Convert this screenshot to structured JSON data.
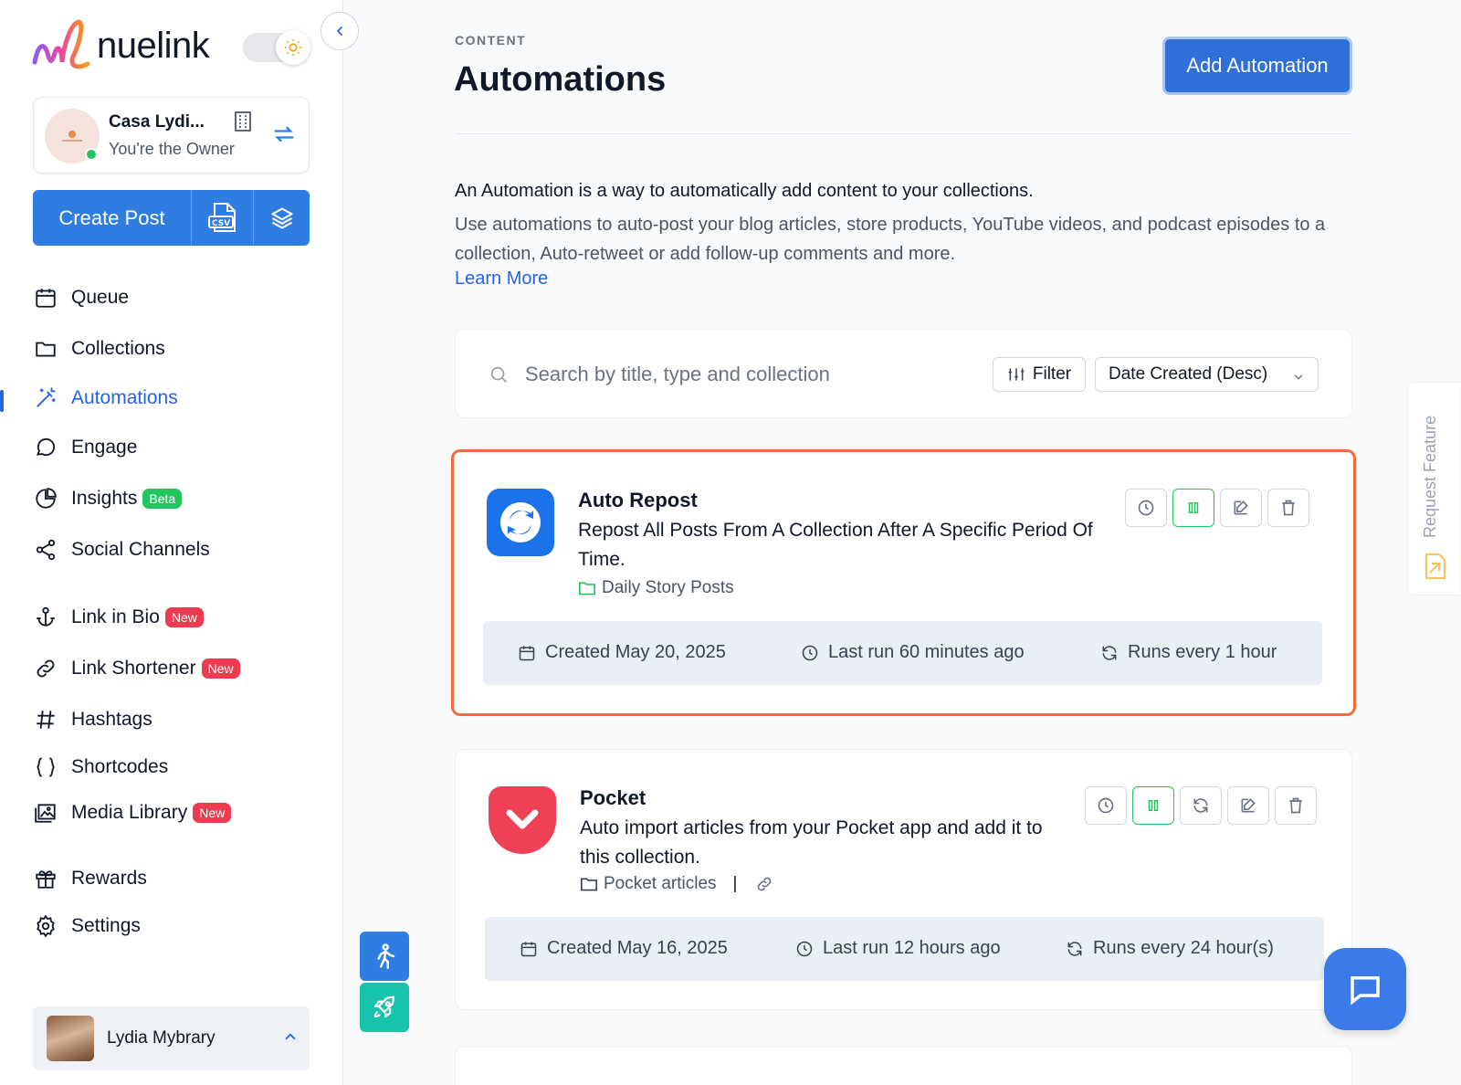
{
  "brand": {
    "name": "nuelink"
  },
  "account": {
    "name": "Casa Lydi...",
    "role": "You're the Owner"
  },
  "create": {
    "label": "Create Post",
    "csv_icon": "csv-file-icon",
    "layers_icon": "layers-icon"
  },
  "nav": {
    "queue": "Queue",
    "collections": "Collections",
    "automations": "Automations",
    "engage": "Engage",
    "insights": "Insights",
    "insights_badge": "Beta",
    "social_channels": "Social Channels",
    "link_in_bio": "Link in Bio",
    "link_in_bio_badge": "New",
    "link_shortener": "Link Shortener",
    "link_shortener_badge": "New",
    "hashtags": "Hashtags",
    "shortcodes": "Shortcodes",
    "media_library": "Media Library",
    "media_library_badge": "New",
    "rewards": "Rewards",
    "settings": "Settings"
  },
  "user": {
    "name": "Lydia Mybrary"
  },
  "header": {
    "breadcrumb": "CONTENT",
    "title": "Automations",
    "add_button": "Add Automation"
  },
  "intro": {
    "line1": "An Automation is a way to automatically add content to your collections.",
    "line2": "Use automations to auto-post your blog articles, store products, YouTube videos, and podcast episodes to a collection, Auto-retweet or add follow-up comments and more.",
    "learn_more": "Learn More"
  },
  "search": {
    "placeholder": "Search by title, type and collection",
    "filter_label": "Filter",
    "sort_value": "Date Created (Desc)"
  },
  "automations": [
    {
      "title": "Auto Repost",
      "description": "Repost All Posts From A Collection After A Specific Period Of Time.",
      "collection": "Daily Story Posts",
      "created": "Created May 20, 2025",
      "last_run": "Last run 60 minutes ago",
      "frequency": "Runs every 1 hour",
      "icon_color": "#1a73e8"
    },
    {
      "title": "Pocket",
      "description": "Auto import articles from your Pocket app and add it to this collection.",
      "collection": "Pocket articles",
      "separator": "|",
      "created": "Created May 16, 2025",
      "last_run": "Last run 12 hours ago",
      "frequency": "Runs every 24 hour(s)",
      "icon_color": "#ef4056"
    }
  ],
  "request_feature": "Request Feature",
  "colors": {
    "primary": "#2f7de1",
    "highlight_border": "#f26b3a",
    "active_green": "#22c55e",
    "new_badge": "#ef3b4f"
  }
}
